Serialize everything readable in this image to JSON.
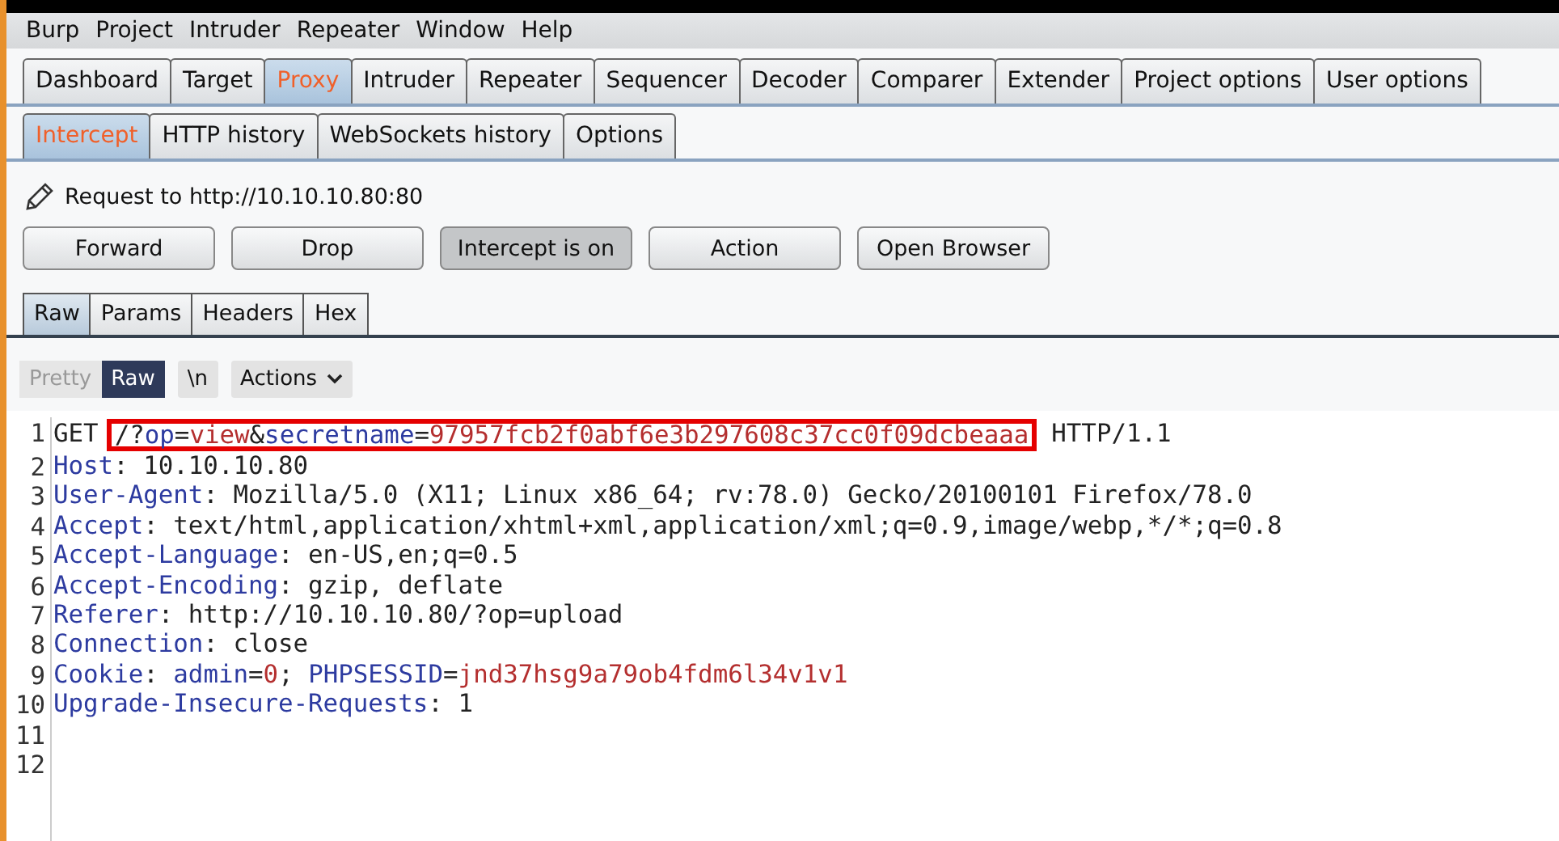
{
  "menu": [
    "Burp",
    "Project",
    "Intruder",
    "Repeater",
    "Window",
    "Help"
  ],
  "tabs": [
    {
      "label": "Dashboard",
      "selected": false
    },
    {
      "label": "Target",
      "selected": false
    },
    {
      "label": "Proxy",
      "selected": true
    },
    {
      "label": "Intruder",
      "selected": false
    },
    {
      "label": "Repeater",
      "selected": false
    },
    {
      "label": "Sequencer",
      "selected": false
    },
    {
      "label": "Decoder",
      "selected": false
    },
    {
      "label": "Comparer",
      "selected": false
    },
    {
      "label": "Extender",
      "selected": false
    },
    {
      "label": "Project options",
      "selected": false
    },
    {
      "label": "User options",
      "selected": false
    }
  ],
  "subtabs": [
    {
      "label": "Intercept",
      "selected": true
    },
    {
      "label": "HTTP history",
      "selected": false
    },
    {
      "label": "WebSockets history",
      "selected": false
    },
    {
      "label": "Options",
      "selected": false
    }
  ],
  "request_label": "Request to http://10.10.10.80:80",
  "buttons": [
    {
      "label": "Forward",
      "on": false
    },
    {
      "label": "Drop",
      "on": false
    },
    {
      "label": "Intercept is on",
      "on": true
    },
    {
      "label": "Action",
      "on": false
    },
    {
      "label": "Open Browser",
      "on": false
    }
  ],
  "view_tabs": [
    {
      "label": "Raw",
      "selected": true
    },
    {
      "label": "Params",
      "selected": false
    },
    {
      "label": "Headers",
      "selected": false
    },
    {
      "label": "Hex",
      "selected": false
    }
  ],
  "editor_toolbar": {
    "modes": [
      {
        "label": "Pretty",
        "selected": false
      },
      {
        "label": "Raw",
        "selected": true
      }
    ],
    "newline_button": "\\n",
    "actions_button": "Actions"
  },
  "lines": [
    {
      "number": "1",
      "tokens": [
        {
          "text": "GET",
          "kind": "plain"
        }
      ],
      "boxed_tokens": [
        {
          "text": "/?",
          "kind": "plain"
        },
        {
          "text": "op",
          "kind": "name"
        },
        {
          "text": "=",
          "kind": "plain"
        },
        {
          "text": "view",
          "kind": "value"
        },
        {
          "text": "&",
          "kind": "plain"
        },
        {
          "text": "secretname",
          "kind": "name"
        },
        {
          "text": "=",
          "kind": "plain"
        },
        {
          "text": "97957fcb2f0abf6e3b297608c37cc0f09dcbeaaa",
          "kind": "value"
        }
      ],
      "tokens_after": [
        {
          "text": "HTTP/1.1",
          "kind": "plain"
        }
      ]
    },
    {
      "number": "2",
      "tokens": [
        {
          "text": "Host",
          "kind": "name"
        },
        {
          "text": ": 10.10.10.80",
          "kind": "plain"
        }
      ]
    },
    {
      "number": "3",
      "tokens": [
        {
          "text": "User-Agent",
          "kind": "name"
        },
        {
          "text": ": Mozilla/5.0 (X11; Linux x86_64; rv:78.0) Gecko/20100101 Firefox/78.0",
          "kind": "plain"
        }
      ]
    },
    {
      "number": "4",
      "tokens": [
        {
          "text": "Accept",
          "kind": "name"
        },
        {
          "text": ": text/html,application/xhtml+xml,application/xml;q=0.9,image/webp,*/*;q=0.8",
          "kind": "plain"
        }
      ]
    },
    {
      "number": "5",
      "tokens": [
        {
          "text": "Accept-Language",
          "kind": "name"
        },
        {
          "text": ": en-US,en;q=0.5",
          "kind": "plain"
        }
      ]
    },
    {
      "number": "6",
      "tokens": [
        {
          "text": "Accept-Encoding",
          "kind": "name"
        },
        {
          "text": ": gzip, deflate",
          "kind": "plain"
        }
      ]
    },
    {
      "number": "7",
      "tokens": [
        {
          "text": "Referer",
          "kind": "name"
        },
        {
          "text": ": http://10.10.10.80/?op=upload",
          "kind": "plain"
        }
      ]
    },
    {
      "number": "8",
      "tokens": [
        {
          "text": "Connection",
          "kind": "name"
        },
        {
          "text": ": close",
          "kind": "plain"
        }
      ]
    },
    {
      "number": "9",
      "tokens": [
        {
          "text": "Cookie",
          "kind": "name"
        },
        {
          "text": ": ",
          "kind": "plain"
        },
        {
          "text": "admin",
          "kind": "name"
        },
        {
          "text": "=",
          "kind": "plain"
        },
        {
          "text": "0",
          "kind": "value"
        },
        {
          "text": "; ",
          "kind": "plain"
        },
        {
          "text": "PHPSESSID",
          "kind": "name"
        },
        {
          "text": "=",
          "kind": "plain"
        },
        {
          "text": "jnd37hsg9a79ob4fdm6l34v1v1",
          "kind": "value"
        }
      ]
    },
    {
      "number": "10",
      "tokens": [
        {
          "text": "Upgrade-Insecure-Requests",
          "kind": "name"
        },
        {
          "text": ": 1",
          "kind": "plain"
        }
      ]
    },
    {
      "number": "11"
    },
    {
      "number": "12"
    }
  ]
}
